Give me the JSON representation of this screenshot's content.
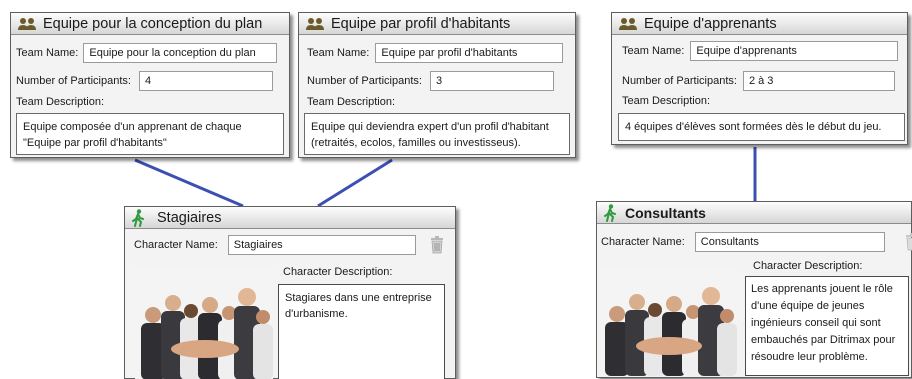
{
  "labels": {
    "team_name": "Team Name:",
    "participants": "Number of Participants:",
    "team_description": "Team Description:",
    "character_name": "Character Name:",
    "character_description": "Character Description:"
  },
  "teams": [
    {
      "title": "Equipe pour la conception du plan",
      "name": "Equipe pour la conception du plan",
      "participants": "4",
      "description": "Equipe composée d'un apprenant de chaque \"Equipe par profil d'habitants\""
    },
    {
      "title": "Equipe par profil d'habitants",
      "name": "Equipe par profil d'habitants",
      "participants": "3",
      "description": "Equipe qui deviendra expert d'un profil d'habitant (retraités, ecolos, familles ou investisseus)."
    },
    {
      "title": "Equipe d'apprenants",
      "name": "Equipe d'apprenants",
      "participants": "2 à 3",
      "description": "4 équipes d'élèves sont formées dès le début du jeu."
    }
  ],
  "characters": [
    {
      "title": "Stagiaires",
      "name": "Stagiaires",
      "description": "Stagiares dans une entreprise d'urbanisme."
    },
    {
      "title": "Consultants",
      "name": "Consultants",
      "description": "Les apprenants jouent le rôle d'une équipe de jeunes ingénieurs conseil qui sont embauchés par Ditrimax pour résoudre leur problème."
    }
  ],
  "colors": {
    "connector": "#3c4fb3",
    "team_icon": "#6a5a2a",
    "character_icon": "#2e9a3e"
  },
  "icons": {
    "team": "team-people-icon",
    "character": "walking-person-icon",
    "delete": "trash-icon"
  }
}
